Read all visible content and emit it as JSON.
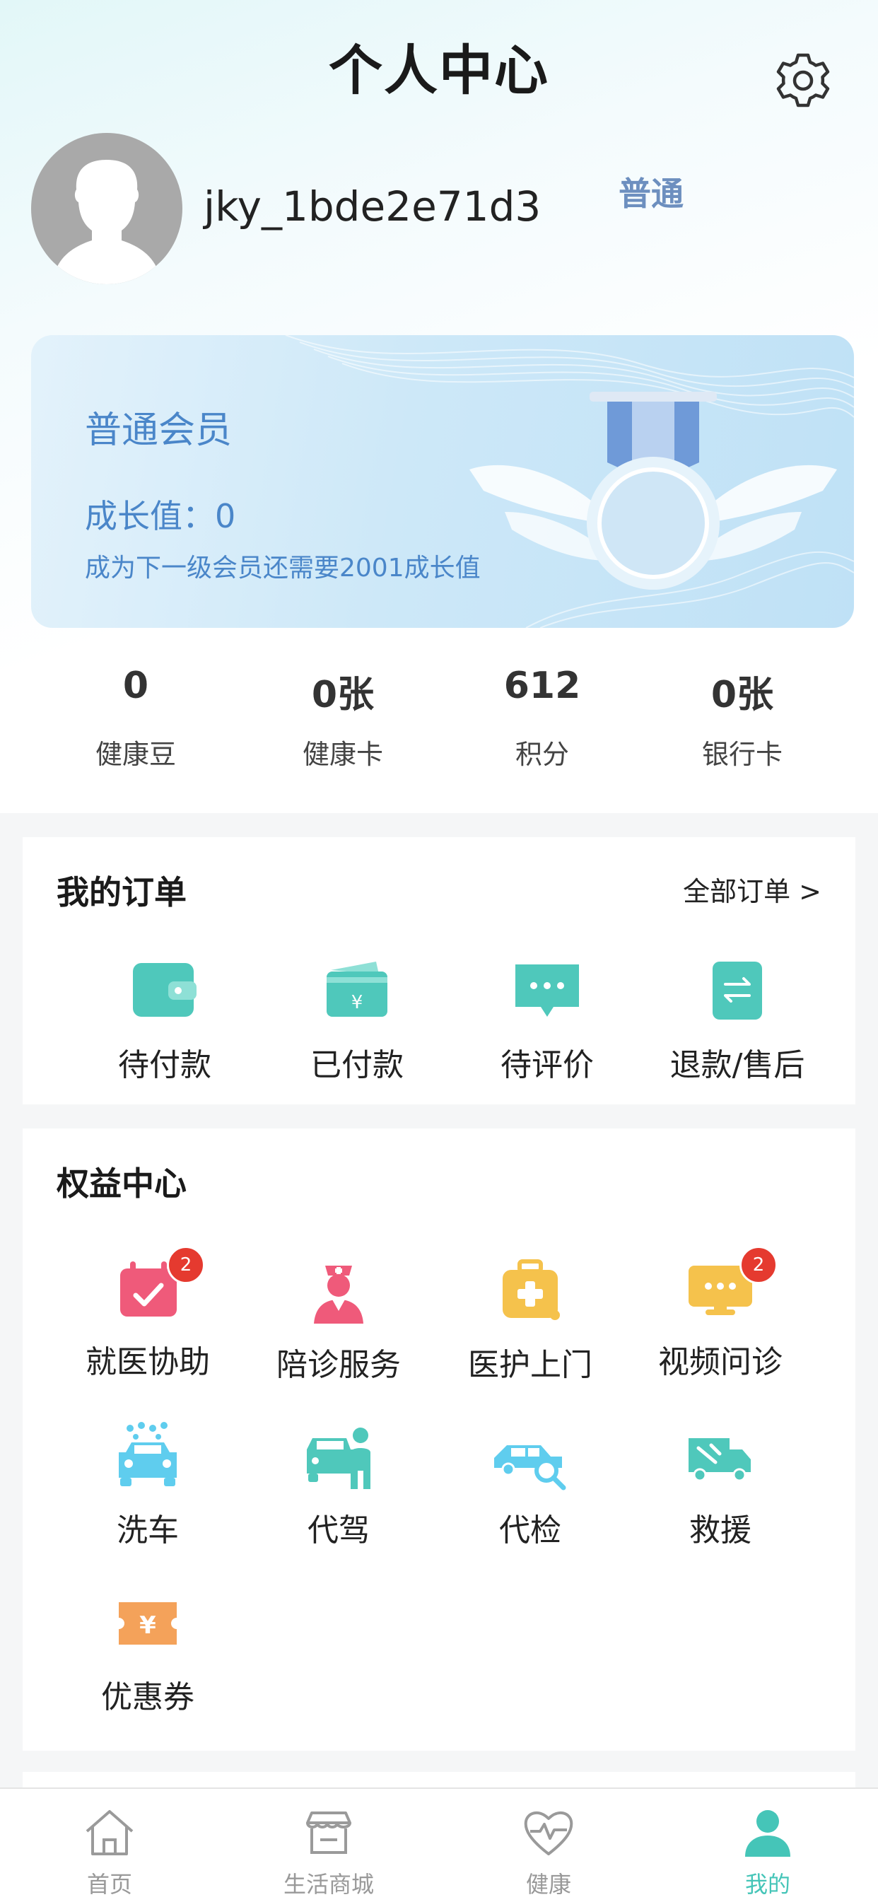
{
  "header": {
    "title": "个人中心"
  },
  "profile": {
    "username": "jky_1bde2e71d3"
  },
  "member_card": {
    "level": "普通会员",
    "growth_label": "成长值：0",
    "next_level_hint": "成为下一级会员还需要2001成长值",
    "badge_text": "普通"
  },
  "stats": [
    {
      "value": "0",
      "label": "健康豆"
    },
    {
      "value": "0张",
      "label": "健康卡"
    },
    {
      "value": "612",
      "label": "积分"
    },
    {
      "value": "0张",
      "label": "银行卡"
    }
  ],
  "orders": {
    "title": "我的订单",
    "all_label": "全部订单 >",
    "items": [
      {
        "label": "待付款",
        "icon": "wallet-icon"
      },
      {
        "label": "已付款",
        "icon": "paid-card-icon"
      },
      {
        "label": "待评价",
        "icon": "comment-icon"
      },
      {
        "label": "退款/售后",
        "icon": "refund-icon"
      }
    ]
  },
  "benefits": {
    "title": "权益中心",
    "items": [
      {
        "label": "就医协助",
        "icon": "calendar-check-icon",
        "badge": "2"
      },
      {
        "label": "陪诊服务",
        "icon": "nurse-icon"
      },
      {
        "label": "医护上门",
        "icon": "medical-kit-icon"
      },
      {
        "label": "视频问诊",
        "icon": "video-consult-icon",
        "badge": "2"
      },
      {
        "label": "洗车",
        "icon": "car-wash-icon"
      },
      {
        "label": "代驾",
        "icon": "chauffeur-icon"
      },
      {
        "label": "代检",
        "icon": "car-inspection-icon"
      },
      {
        "label": "救援",
        "icon": "tow-truck-icon"
      },
      {
        "label": "优惠券",
        "icon": "coupon-icon"
      }
    ]
  },
  "tabbar": [
    {
      "label": "首页",
      "icon": "home-icon"
    },
    {
      "label": "生活商城",
      "icon": "store-icon"
    },
    {
      "label": "健康",
      "icon": "heartbeat-icon"
    },
    {
      "label": "我的",
      "icon": "user-icon",
      "active": true
    }
  ],
  "colors": {
    "accent": "#45c5b8",
    "member_text": "#4a86c9",
    "badge_red": "#e53a2f",
    "pink": "#ef5a7a",
    "yellow": "#f5c24c",
    "sky": "#5fcdee",
    "orange": "#f4a25a"
  }
}
